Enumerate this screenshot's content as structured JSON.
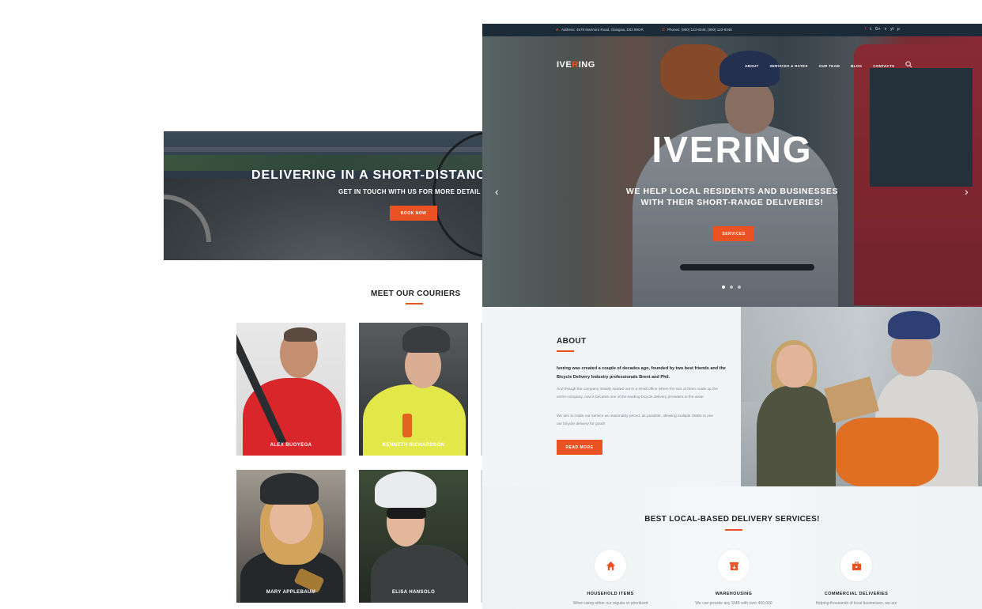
{
  "back_page": {
    "cta": {
      "title": "DELIVERING IN A SHORT-DISTANCE",
      "subtitle": "GET IN TOUCH WITH US FOR MORE DETAIL",
      "button": "BOOK NOW"
    },
    "couriers_section": {
      "title": "MEET OUR COURIERS",
      "couriers": [
        {
          "name": "ALEX BUOYEGA"
        },
        {
          "name": "KENNETH RICHARDSON"
        },
        {
          "name": "MARY APPLEBAUM"
        },
        {
          "name": "ELISA HANSOLO"
        }
      ]
    }
  },
  "front_page": {
    "topbar": {
      "address": "Address: 4578 Marmora Road, Glasgow, D04 89GR",
      "phones": "Phones: (800) 123-0045; (800) 123-0046",
      "socials": [
        "f",
        "t",
        "G+",
        "v",
        "yt",
        "p"
      ]
    },
    "nav": {
      "logo_prefix": "IVE",
      "logo_accent": "R",
      "logo_suffix": "ING",
      "menu": [
        "ABOUT",
        "SERVICES & RATES",
        "OUR TEAM",
        "BLOG",
        "CONTACTS"
      ]
    },
    "hero": {
      "title": "IVERING",
      "subtitle_line1": "WE HELP LOCAL RESIDENTS AND BUSINESSES",
      "subtitle_line2": "WITH THEIR SHORT-RANGE DELIVERIES!",
      "button": "SERVICES",
      "arrow_left": "‹",
      "arrow_right": "›"
    },
    "about": {
      "title": "ABOUT",
      "lead": "Ivering was created a couple of decades ago, founded by two best friends and the Bicycle Delivery Industry professionals Brent and Phil.",
      "paragraph1": "And though the company initially started out in a small office where the two of them made up the entire company, now it became one of the leading bicycle delivery providers in the area!",
      "paragraph2": "We aim to make our service as reasonably priced, as possible, allowing multiple SMBs to use our bicycle delivery for good!",
      "button": "READ MORE"
    },
    "services": {
      "title": "BEST LOCAL-BASED DELIVERY SERVICES!",
      "items": [
        {
          "name": "HOUSEHOLD ITEMS",
          "desc": "When using either our regular or prioritized",
          "icon": "home-icon"
        },
        {
          "name": "WAREHOUSING",
          "desc": "We can provide any SMB with over 400,000",
          "icon": "warehouse-box-icon"
        },
        {
          "name": "COMMERCIAL DELIVERIES",
          "desc": "Helping thousands of local businesses, we are",
          "icon": "briefcase-icon"
        }
      ]
    },
    "colors": {
      "accent": "#ea5224",
      "topbar": "#1c2b38"
    }
  }
}
